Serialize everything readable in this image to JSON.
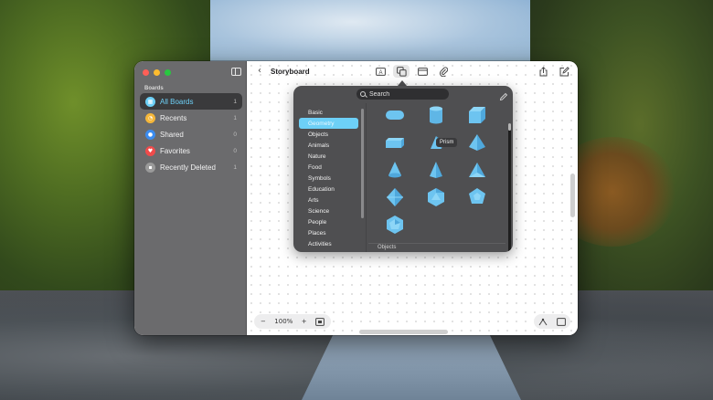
{
  "sidebar": {
    "heading": "Boards",
    "items": [
      {
        "label": "All Boards",
        "count": "1",
        "icon": "board-icon",
        "color": "#6dd0f7"
      },
      {
        "label": "Recents",
        "count": "1",
        "icon": "clock-icon",
        "color": "#f5b73a"
      },
      {
        "label": "Shared",
        "count": "0",
        "icon": "people-icon",
        "color": "#3b8cf0"
      },
      {
        "label": "Favorites",
        "count": "0",
        "icon": "heart-icon",
        "color": "#ef4b4b"
      },
      {
        "label": "Recently Deleted",
        "count": "1",
        "icon": "trash-icon",
        "color": "#9a9a9a"
      }
    ]
  },
  "toolbar": {
    "title": "Storyboard",
    "tools": [
      "text-box-icon",
      "shapes-icon",
      "media-icon",
      "attachment-icon"
    ],
    "right": [
      "share-icon",
      "compose-icon"
    ]
  },
  "shapes_popover": {
    "search_placeholder": "Search",
    "categories": [
      "Basic",
      "Geometry",
      "Objects",
      "Animals",
      "Nature",
      "Food",
      "Symbols",
      "Education",
      "Arts",
      "Science",
      "People",
      "Places",
      "Activities"
    ],
    "selected_category": "Geometry",
    "hovered_tooltip": "Prism",
    "next_section": "Objects",
    "shape_color": "#6dc4f0"
  },
  "zoom": {
    "minus": "−",
    "level": "100%",
    "plus": "+"
  },
  "colors": {
    "accent": "#6dd0f7",
    "sidebar_bg": "#6b6b6d",
    "popover_bg": "#4f4f51"
  }
}
